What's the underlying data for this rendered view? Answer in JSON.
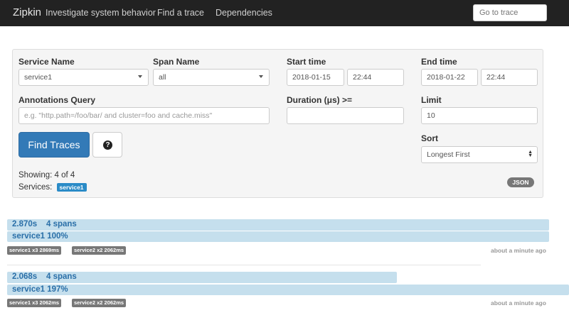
{
  "navbar": {
    "brand": "Zipkin",
    "tagline": "Investigate system behavior",
    "links": [
      "Find a trace",
      "Dependencies"
    ],
    "goto_placeholder": "Go to trace"
  },
  "search": {
    "service_label": "Service Name",
    "service_value": "service1",
    "span_label": "Span Name",
    "span_value": "all",
    "start_label": "Start time",
    "start_date": "2018-01-15",
    "start_time": "22:44",
    "end_label": "End time",
    "end_date": "2018-01-22",
    "end_time": "22:44",
    "annotations_label": "Annotations Query",
    "annotations_placeholder": "e.g. \"http.path=/foo/bar/ and cluster=foo and cache.miss\"",
    "duration_label": "Duration (μs) >=",
    "duration_value": "",
    "limit_label": "Limit",
    "limit_value": "10",
    "sort_label": "Sort",
    "sort_value": "Longest First",
    "find_button": "Find Traces",
    "help_icon": "question-circle-icon"
  },
  "results": {
    "showing": "Showing: 4 of 4",
    "services_label": "Services:",
    "services_badge": "service1",
    "json_button": "JSON"
  },
  "traces": [
    {
      "duration": "2.870s",
      "spans": "4 spans",
      "service": "service1 100%",
      "tags": [
        "service1 x3 2869ms",
        "service2 x2 2062ms"
      ],
      "time_ago": "about a minute ago"
    },
    {
      "duration": "2.068s",
      "spans": "4 spans",
      "service": "service1 197%",
      "tags": [
        "service1 x3 2062ms",
        "service2 x2 2062ms"
      ],
      "time_ago": "about a minute ago"
    }
  ],
  "colors": {
    "navbar_bg": "#222222",
    "primary": "#337ab7",
    "trace_bar": "#c5dfed",
    "trace_text": "#2a6fa8",
    "tag_bg": "#777777",
    "service_badge": "#2a8bc7"
  }
}
